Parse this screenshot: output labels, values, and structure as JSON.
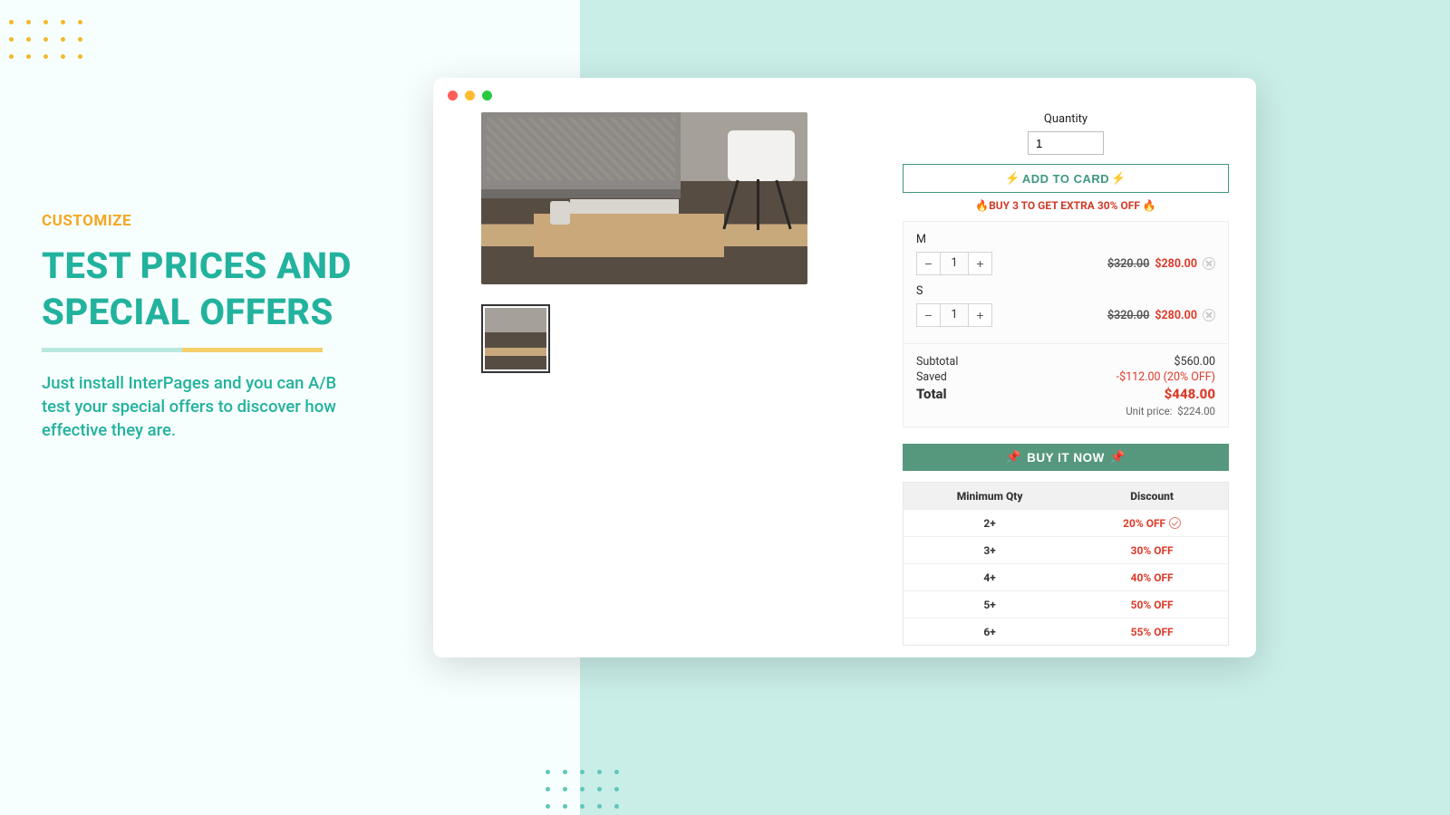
{
  "promo": {
    "eyebrow": "CUSTOMIZE",
    "headline_l1": "TEST PRICES AND",
    "headline_l2": "SPECIAL OFFERS",
    "body": "Just install InterPages and you can A/B test your special offers to discover how effective they are."
  },
  "product": {
    "quantity_label": "Quantity",
    "quantity_value": "1",
    "add_to_cart": "ADD TO CARD",
    "bolt": "⚡",
    "promo_line": "🔥BUY 3 TO GET EXTRA 30% OFF 🔥",
    "variants": [
      {
        "name": "M",
        "qty": "1",
        "orig": "$320.00",
        "sale": "$280.00"
      },
      {
        "name": "S",
        "qty": "1",
        "orig": "$320.00",
        "sale": "$280.00"
      }
    ],
    "totals": {
      "subtotal_label": "Subtotal",
      "subtotal": "$560.00",
      "saved_label": "Saved",
      "saved": "-$112.00 (20% OFF)",
      "total_label": "Total",
      "total": "$448.00",
      "unit_label": "Unit price:",
      "unit": "$224.00"
    },
    "buy_now": "BUY IT NOW",
    "buy_emoji": "📌",
    "discount_table": {
      "headers": [
        "Minimum Qty",
        "Discount"
      ],
      "rows": [
        {
          "qty": "2+",
          "off": "20% OFF",
          "checked": true
        },
        {
          "qty": "3+",
          "off": "30% OFF"
        },
        {
          "qty": "4+",
          "off": "40% OFF"
        },
        {
          "qty": "5+",
          "off": "50% OFF"
        },
        {
          "qty": "6+",
          "off": "55% OFF"
        }
      ]
    }
  }
}
